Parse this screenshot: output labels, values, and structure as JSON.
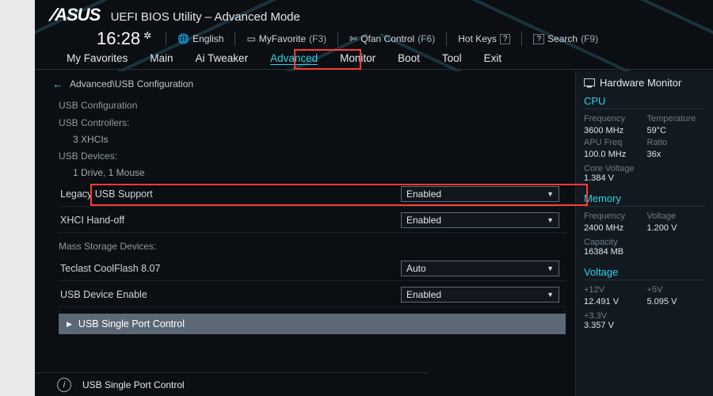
{
  "header": {
    "brand": "ASUS",
    "title": "UEFI BIOS Utility – Advanced Mode",
    "clock": "16:28",
    "toolbar": {
      "language": "English",
      "myfavorite": {
        "label": "MyFavorite",
        "hint": "(F3)"
      },
      "qfan": {
        "label": "Qfan Control",
        "hint": "(F6)"
      },
      "hotkeys": {
        "label": "Hot Keys",
        "box": "?"
      },
      "search": {
        "label": "Search",
        "hint": "(F9)"
      }
    }
  },
  "tabs": [
    {
      "label": "My Favorites",
      "active": false
    },
    {
      "label": "Main",
      "active": false
    },
    {
      "label": "Ai Tweaker",
      "active": false
    },
    {
      "label": "Advanced",
      "active": true
    },
    {
      "label": "Monitor",
      "active": false
    },
    {
      "label": "Boot",
      "active": false
    },
    {
      "label": "Tool",
      "active": false
    },
    {
      "label": "Exit",
      "active": false
    }
  ],
  "breadcrumb": "Advanced\\USB Configuration",
  "content": {
    "header": "USB Configuration",
    "controllers_label": "USB Controllers:",
    "controllers_value": "3 XHCIs",
    "devices_label": "USB Devices:",
    "devices_value": "1 Drive, 1 Mouse",
    "settings": [
      {
        "label": "Legacy USB Support",
        "value": "Enabled",
        "highlight": true
      },
      {
        "label": "XHCI Hand-off",
        "value": "Enabled"
      }
    ],
    "mass_label": "Mass Storage Devices:",
    "mass_items": [
      {
        "label": "Teclast CoolFlash 8.07",
        "value": "Auto"
      }
    ],
    "settings2": [
      {
        "label": "USB Device Enable",
        "value": "Enabled"
      }
    ],
    "submenu": "USB Single Port Control"
  },
  "footer_help": "USB Single Port Control",
  "side": {
    "title": "Hardware Monitor",
    "cpu": {
      "heading": "CPU",
      "rows": [
        {
          "k": "Frequency",
          "v": "3600 MHz",
          "k2": "Temperature",
          "v2": "59°C"
        },
        {
          "k": "APU Freq",
          "v": "100.0 MHz",
          "k2": "Ratio",
          "v2": "36x"
        }
      ],
      "single": {
        "k": "Core Voltage",
        "v": "1.384 V"
      }
    },
    "memory": {
      "heading": "Memory",
      "rows": [
        {
          "k": "Frequency",
          "v": "2400 MHz",
          "k2": "Voltage",
          "v2": "1.200 V"
        }
      ],
      "single": {
        "k": "Capacity",
        "v": "16384 MB"
      }
    },
    "voltage": {
      "heading": "Voltage",
      "rows": [
        {
          "k": "+12V",
          "v": "12.491 V",
          "k2": "+5V",
          "v2": "5.095 V"
        }
      ],
      "single": {
        "k": "+3.3V",
        "v": "3.357 V"
      }
    }
  }
}
